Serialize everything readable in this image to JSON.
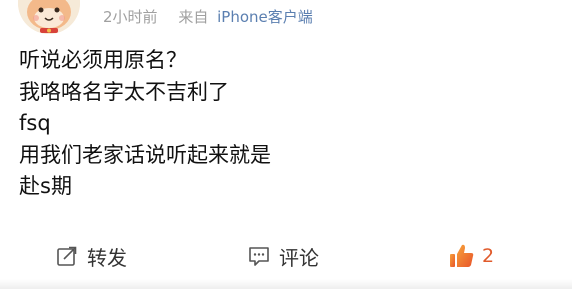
{
  "post": {
    "meta": {
      "time": "2小时前",
      "source_prefix": "来自",
      "source_device": "iPhone客户端"
    },
    "content_lines": [
      "听说必须用原名？",
      "我咯咯名字太不吉利了",
      "fsq",
      "用我们老家话说听起来就是",
      "赴s期"
    ]
  },
  "actions": {
    "repost_label": "转发",
    "comment_label": "评论",
    "like_count": "2",
    "like_icon": "thumbs-up-icon",
    "repost_icon": "repost-icon",
    "comment_icon": "comment-icon"
  },
  "colors": {
    "meta_text": "#a0a0a0",
    "source_link": "#5b7fb0",
    "like_accent": "#e05a2b"
  }
}
